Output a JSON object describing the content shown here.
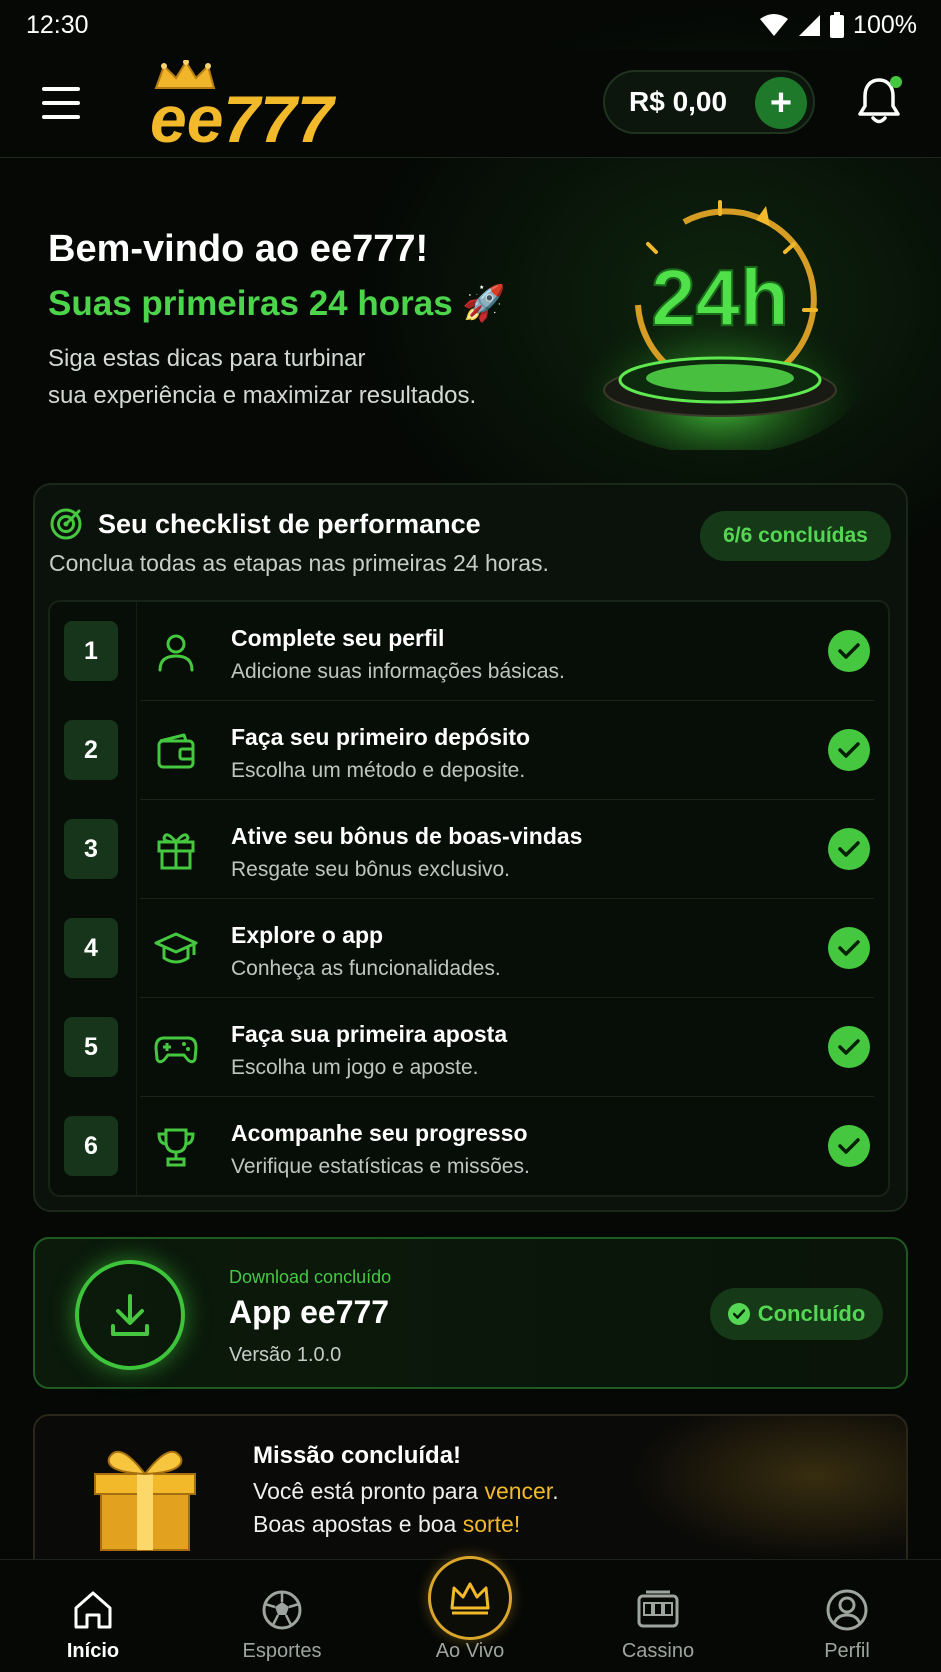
{
  "status_bar": {
    "time": "12:30",
    "battery": "100%"
  },
  "header": {
    "logo_text": "ee777",
    "balance": "R$ 0,00",
    "add_label": "+"
  },
  "hero": {
    "title": "Bem-vindo ao ee777!",
    "subtitle": "Suas primeiras 24 horas",
    "subtitle_emoji": "🚀",
    "description_line1": "Siga estas dicas para turbinar",
    "description_line2": "sua experiência e maximizar resultados.",
    "art_text": "24h"
  },
  "checklist": {
    "title": "Seu checklist de performance",
    "description": "Conclua todas as etapas nas primeiras 24 horas.",
    "progress": "6/6 concluídas",
    "items": [
      {
        "num": "1",
        "title": "Complete seu perfil",
        "desc": "Adicione suas informações básicas.",
        "icon": "user-icon"
      },
      {
        "num": "2",
        "title": "Faça seu primeiro depósito",
        "desc": "Escolha um método e deposite.",
        "icon": "wallet-icon"
      },
      {
        "num": "3",
        "title": "Ative seu bônus de boas-vindas",
        "desc": "Resgate seu bônus exclusivo.",
        "icon": "gift-icon"
      },
      {
        "num": "4",
        "title": "Explore o app",
        "desc": "Conheça as funcionalidades.",
        "icon": "graduation-cap-icon"
      },
      {
        "num": "5",
        "title": "Faça sua primeira aposta",
        "desc": "Escolha um jogo e aposte.",
        "icon": "gamepad-icon"
      },
      {
        "num": "6",
        "title": "Acompanhe seu progresso",
        "desc": "Verifique estatísticas e missões.",
        "icon": "trophy-icon"
      }
    ]
  },
  "download": {
    "eyebrow": "Download concluído",
    "title": "App ee777",
    "version": "Versão 1.0.0",
    "badge": "Concluído"
  },
  "mission": {
    "title": "Missão concluída!",
    "line1_pre": "Você está pronto para ",
    "line1_gold": "vencer",
    "line1_post": ".",
    "line2_pre": "Boas apostas e boa ",
    "line2_gold": "sorte!"
  },
  "nav": {
    "home": "Início",
    "sports": "Esportes",
    "live": "Ao Vivo",
    "casino": "Cassino",
    "profile": "Perfil"
  },
  "colors": {
    "accent_green": "#45c83f",
    "gold": "#f2b92a",
    "background": "#050805"
  }
}
